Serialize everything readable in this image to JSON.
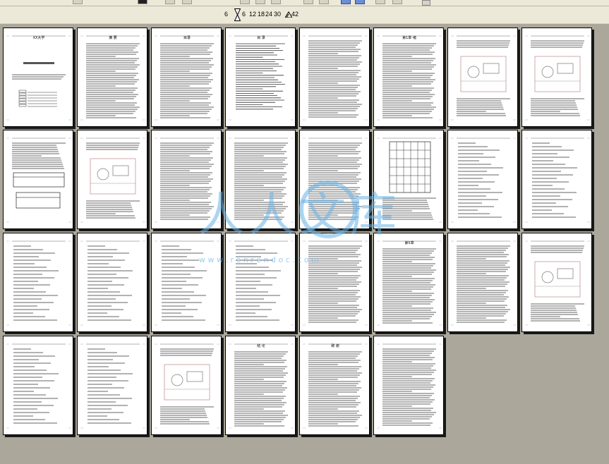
{
  "zoom": {
    "min_label": "6",
    "steps": [
      "6",
      "12",
      "18",
      "24",
      "30"
    ],
    "max_label": "42"
  },
  "watermark": {
    "chinese": "人人文库",
    "url": "w w w . r e n r e n d o c . c o m"
  },
  "pages": [
    {
      "kind": "cover",
      "heading": "XX大学"
    },
    {
      "kind": "text",
      "heading": "摘 要"
    },
    {
      "kind": "text",
      "heading": "目录"
    },
    {
      "kind": "toc",
      "heading": "目 录"
    },
    {
      "kind": "text",
      "heading": ""
    },
    {
      "kind": "text",
      "heading": "第1章 绪"
    },
    {
      "kind": "drawing",
      "heading": ""
    },
    {
      "kind": "drawing",
      "heading": ""
    },
    {
      "kind": "table",
      "heading": ""
    },
    {
      "kind": "drawing",
      "heading": ""
    },
    {
      "kind": "text",
      "heading": ""
    },
    {
      "kind": "text",
      "heading": ""
    },
    {
      "kind": "text",
      "heading": ""
    },
    {
      "kind": "grid",
      "heading": ""
    },
    {
      "kind": "formula",
      "heading": ""
    },
    {
      "kind": "formula",
      "heading": ""
    },
    {
      "kind": "formula",
      "heading": ""
    },
    {
      "kind": "formula",
      "heading": ""
    },
    {
      "kind": "formula",
      "heading": ""
    },
    {
      "kind": "formula",
      "heading": ""
    },
    {
      "kind": "text",
      "heading": ""
    },
    {
      "kind": "text",
      "heading": "第5章"
    },
    {
      "kind": "text",
      "heading": ""
    },
    {
      "kind": "drawing",
      "heading": ""
    },
    {
      "kind": "formula",
      "heading": ""
    },
    {
      "kind": "formula",
      "heading": ""
    },
    {
      "kind": "drawing",
      "heading": ""
    },
    {
      "kind": "text",
      "heading": "结 论"
    },
    {
      "kind": "text",
      "heading": "致 谢"
    },
    {
      "kind": "text",
      "heading": ""
    }
  ]
}
